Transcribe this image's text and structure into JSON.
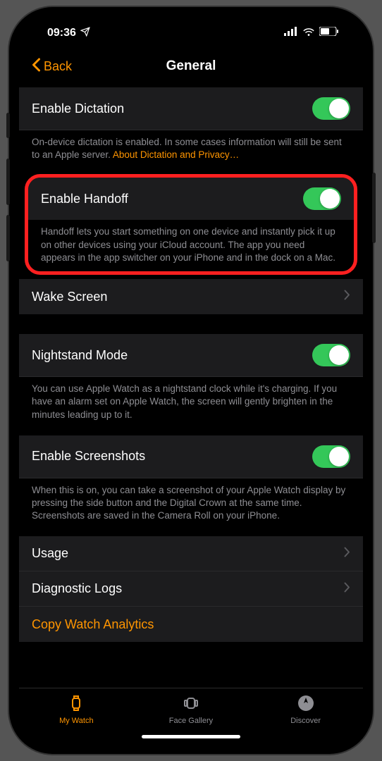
{
  "statusbar": {
    "time": "09:36"
  },
  "nav": {
    "back": "Back",
    "title": "General"
  },
  "rows": {
    "dictation": {
      "label": "Enable Dictation",
      "footer": "On-device dictation is enabled. In some cases information will still be sent to an Apple server. ",
      "link": "About Dictation and Privacy…"
    },
    "handoff": {
      "label": "Enable Handoff",
      "footer": "Handoff lets you start something on one device and instantly pick it up on other devices using your iCloud account. The app you need appears in the app switcher on your iPhone and in the dock on a Mac."
    },
    "wake": {
      "label": "Wake Screen"
    },
    "nightstand": {
      "label": "Nightstand Mode",
      "footer": "You can use Apple Watch as a nightstand clock while it's charging. If you have an alarm set on Apple Watch, the screen will gently brighten in the minutes leading up to it."
    },
    "screenshots": {
      "label": "Enable Screenshots",
      "footer": "When this is on, you can take a screenshot of your Apple Watch display by pressing the side button and the Digital Crown at the same time. Screenshots are saved in the Camera Roll on your iPhone."
    },
    "usage": {
      "label": "Usage"
    },
    "diagnostic": {
      "label": "Diagnostic Logs"
    },
    "analytics": {
      "label": "Copy Watch Analytics"
    }
  },
  "tabs": {
    "mywatch": "My Watch",
    "gallery": "Face Gallery",
    "discover": "Discover"
  }
}
